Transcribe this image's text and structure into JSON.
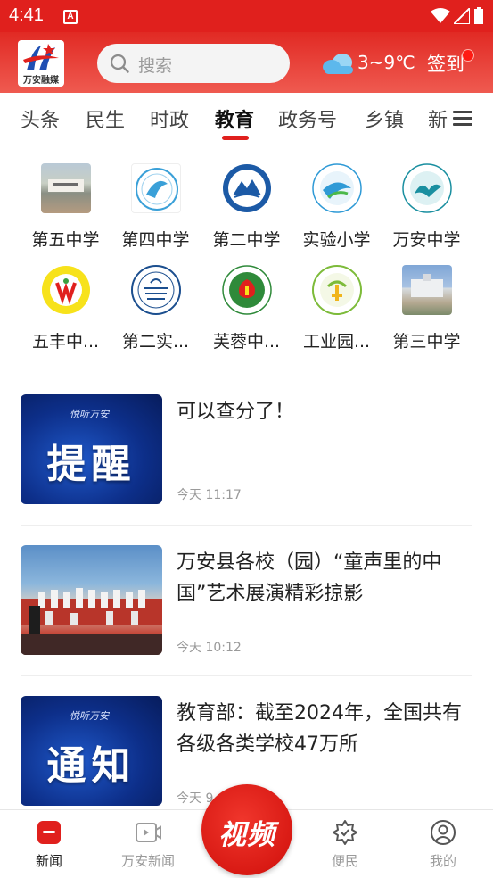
{
  "status_bar": {
    "time": "4:41",
    "notification_icon": "A"
  },
  "header": {
    "logo_text": "万安融媒",
    "search_placeholder": "搜索",
    "weather": "3~9℃",
    "signin_label": "签到",
    "colors": {
      "brand_red": "#e0201d"
    }
  },
  "tabs": {
    "items": [
      "头条",
      "民生",
      "时政",
      "教育",
      "政务号",
      "乡镇"
    ],
    "active": "教育",
    "more_partial": "新"
  },
  "schools": [
    {
      "name": "第五中学",
      "logo": "school-photo"
    },
    {
      "name": "第四中学",
      "logo": "school-emblem"
    },
    {
      "name": "第二中学",
      "logo": "school-emblem"
    },
    {
      "name": "实验小学",
      "logo": "school-emblem"
    },
    {
      "name": "万安中学",
      "logo": "school-emblem"
    },
    {
      "name": "五丰中...",
      "logo": "school-emblem"
    },
    {
      "name": "第二实...",
      "logo": "school-emblem"
    },
    {
      "name": "芙蓉中...",
      "logo": "school-emblem"
    },
    {
      "name": "工业园...",
      "logo": "school-emblem"
    },
    {
      "name": "第三中学",
      "logo": "school-photo"
    }
  ],
  "news": [
    {
      "title": "可以查分了！",
      "time": "今天 11:17",
      "thumb_brand": "悦听万安",
      "thumb_text": "提醒",
      "thumb_kind": "banner"
    },
    {
      "title": "万安县各校（园）“童声里的中国”艺术展演精彩掠影",
      "time": "今天 10:12",
      "thumb_kind": "photo"
    },
    {
      "title": "教育部：截至2024年，全国共有各级各类学校47万所",
      "time": "今天 9",
      "thumb_brand": "悦听万安",
      "thumb_text": "通知",
      "thumb_kind": "banner"
    }
  ],
  "bottom_nav": {
    "items": [
      {
        "label": "新闻",
        "icon": "news-icon",
        "active": true
      },
      {
        "label": "万安新闻",
        "icon": "video-screen-icon",
        "active": false
      },
      {
        "label": "便民",
        "icon": "service-badge-icon",
        "active": false
      },
      {
        "label": "我的",
        "icon": "profile-icon",
        "active": false
      }
    ],
    "center_button": "视频"
  }
}
